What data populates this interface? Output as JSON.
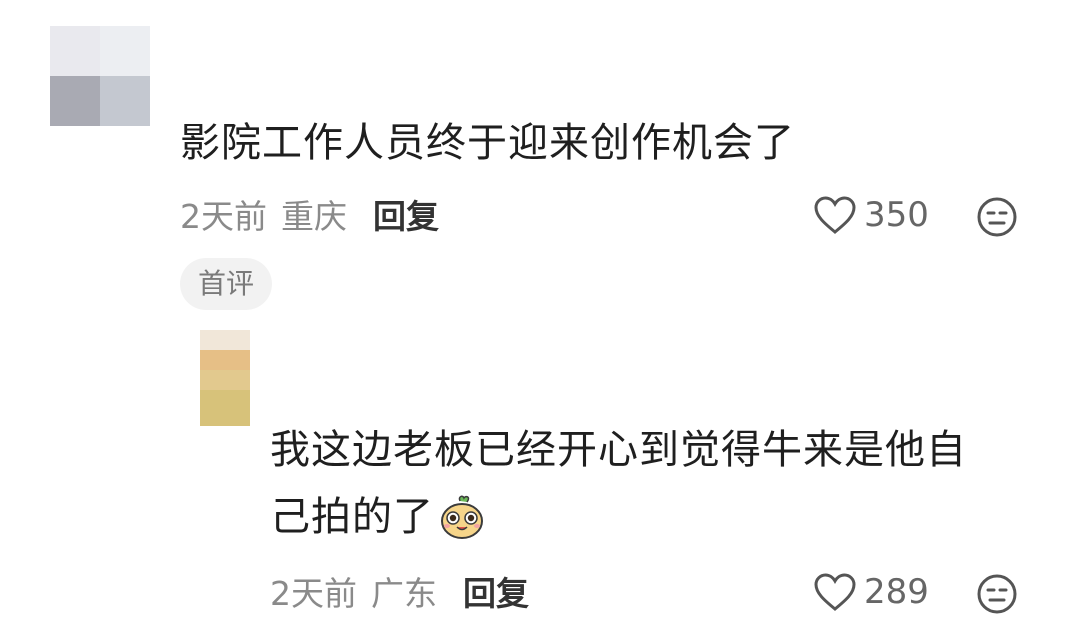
{
  "comments": [
    {
      "text": "影院工作人员终于迎来创作机会了",
      "time": "2天前",
      "location": "重庆",
      "reply_label": "回复",
      "likes": "350",
      "badge": "首评"
    },
    {
      "text_line1": "我这边老板已经开心到觉得牛来是他自",
      "text_line2": "己拍的了",
      "time": "2天前",
      "location": "广东",
      "reply_label": "回复",
      "likes": "289"
    }
  ],
  "icons": {
    "like": "heart-outline-icon",
    "react": "neutral-face-icon",
    "sticker": "cute-creature-emoji"
  },
  "colors": {
    "text": "#1f1f1f",
    "meta": "#8a8a8a",
    "badge_bg": "#f2f2f2"
  }
}
